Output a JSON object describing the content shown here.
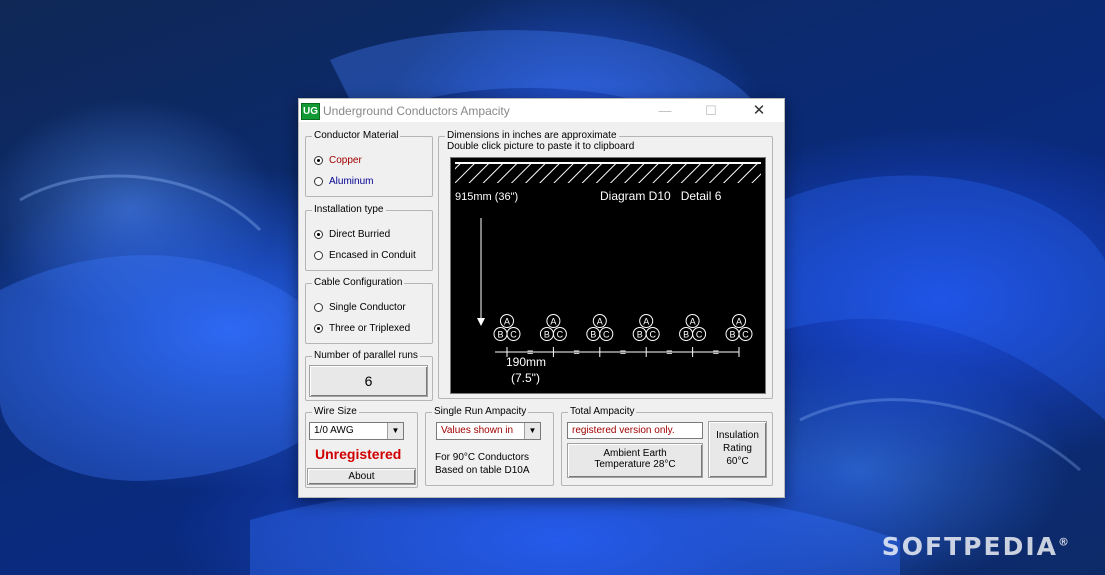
{
  "wallpaper": {
    "watermark": "SOFTPEDIA",
    "watermark_mark": "®"
  },
  "window": {
    "icon_text": "UG",
    "title": "Underground Conductors Ampacity",
    "controls": {
      "minimize": "—",
      "maximize": "☐",
      "close": "✕"
    }
  },
  "conductor_material": {
    "label": "Conductor Material",
    "options": [
      {
        "label": "Copper",
        "selected": true,
        "color": "#a00000"
      },
      {
        "label": "Aluminum",
        "selected": false,
        "color": "#000090"
      }
    ]
  },
  "installation_type": {
    "label": "Installation type",
    "options": [
      {
        "label": "Direct Burried",
        "selected": true
      },
      {
        "label": "Encased in Conduit",
        "selected": false
      }
    ]
  },
  "cable_configuration": {
    "label": "Cable Configuration",
    "options": [
      {
        "label": "Single Conductor",
        "selected": false
      },
      {
        "label": "Three or Triplexed",
        "selected": true
      }
    ]
  },
  "parallel_runs": {
    "label": "Number of parallel runs",
    "value": "6"
  },
  "dimensions": {
    "label": "Dimensions in inches are approximate",
    "hint": "Double click picture to paste it to clipboard",
    "depth": "915mm (36\")",
    "diagram_title": "Diagram D10   Detail 6",
    "spacing_mm": "190mm",
    "spacing_in": "(7.5\")",
    "conductor_letters": [
      "A",
      "B",
      "C"
    ],
    "equal_sign": "=",
    "triplex_count": 6
  },
  "wire_size": {
    "label": "Wire Size",
    "value": "1/0 AWG",
    "status": "Unregistered",
    "about_button": "About"
  },
  "single_run": {
    "label": "Single Run Ampacity",
    "value": "Values shown in",
    "note_line1": "For 90°C Conductors",
    "note_line2": "Based on table D10A"
  },
  "total_ampacity": {
    "label": "Total Ampacity",
    "value": "registered version only.",
    "ambient_line1": "Ambient Earth",
    "ambient_line2": "Temperature 28°C",
    "insulation_line1": "Insulation",
    "insulation_line2": "Rating",
    "insulation_line3": "60°C"
  },
  "colors": {
    "accent_red": "#a00000",
    "accent_blue": "#000090",
    "icon_green": "#119a34"
  }
}
